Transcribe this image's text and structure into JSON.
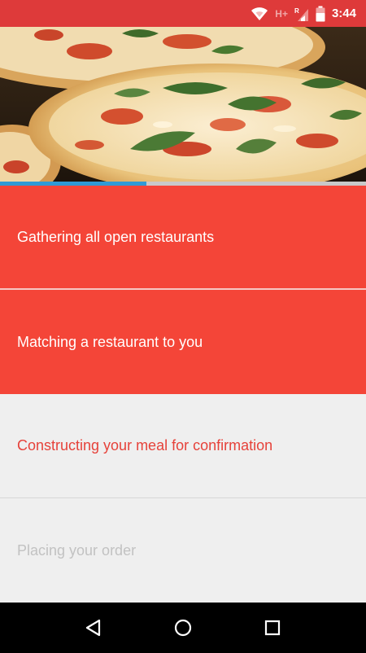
{
  "status_bar": {
    "network_label": "H+",
    "roaming_label": "R",
    "time": "3:44",
    "icons": [
      "wifi-icon",
      "signal-icon",
      "battery-icon"
    ]
  },
  "hero": {
    "image": "pizza-photo"
  },
  "progress": {
    "fraction": 0.4
  },
  "steps": [
    {
      "label": "Gathering all open restaurants",
      "state": "done"
    },
    {
      "label": "Matching a restaurant to you",
      "state": "done"
    },
    {
      "label": "Constructing your meal for confirmation",
      "state": "active"
    },
    {
      "label": "Placing your order",
      "state": "pending"
    }
  ],
  "nav_bar": {
    "buttons": [
      "back-icon",
      "home-icon",
      "recents-icon"
    ]
  },
  "colors": {
    "status_bar": "#de3a3a",
    "step_done": "#f44538",
    "step_active_text": "#e6423a",
    "step_pending_text": "#c2c2c2",
    "progress": "#2f9ad6"
  }
}
